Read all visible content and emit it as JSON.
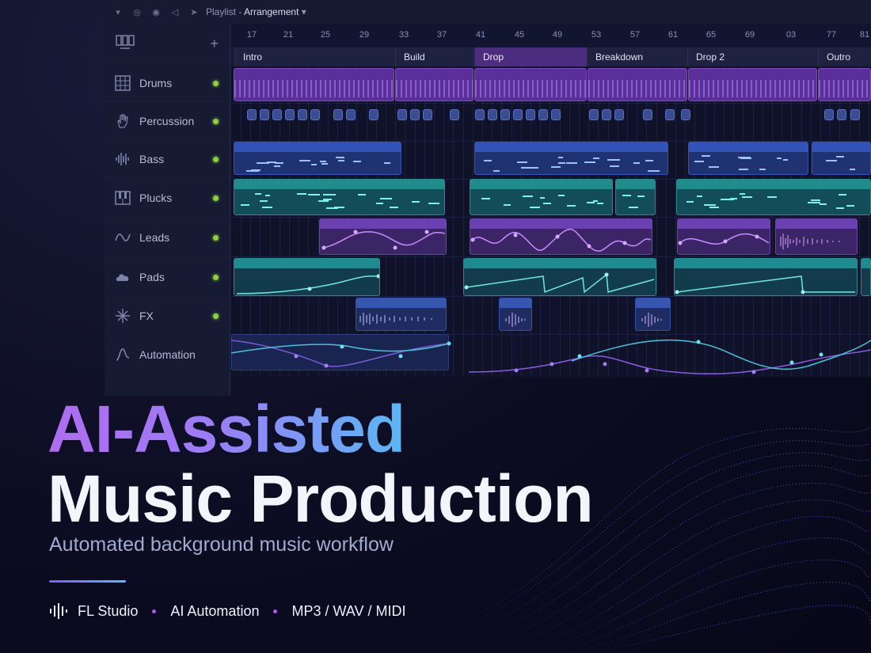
{
  "topbar": {
    "icons": [
      "chevron-down-icon",
      "headphones-icon",
      "record-icon",
      "speaker-icon",
      "arrow-icon"
    ],
    "title_prefix": "Playlist",
    "title_separator": " - ",
    "title_main": "Arrangement",
    "dropdown_icon": "▾"
  },
  "sidebar": {
    "add_label": "+",
    "tracks": [
      {
        "name": "Drums",
        "icon": "grid-icon",
        "active": true
      },
      {
        "name": "Percussion",
        "icon": "hand-icon",
        "active": true
      },
      {
        "name": "Bass",
        "icon": "waveform-icon",
        "active": true
      },
      {
        "name": "Plucks",
        "icon": "piano-keys-icon",
        "active": true
      },
      {
        "name": "Leads",
        "icon": "sine-wave-icon",
        "active": true
      },
      {
        "name": "Pads",
        "icon": "cloud-icon",
        "active": true
      },
      {
        "name": "FX",
        "icon": "sparkle-icon",
        "active": true
      },
      {
        "name": "Automation",
        "icon": "curve-icon",
        "active": false
      }
    ]
  },
  "ruler": {
    "bars": [
      "17",
      "21",
      "25",
      "29",
      "33",
      "37",
      "41",
      "45",
      "49",
      "53",
      "57",
      "61",
      "65",
      "69",
      "03",
      "77",
      "81"
    ]
  },
  "sections": [
    {
      "label": "Intro"
    },
    {
      "label": "Build"
    },
    {
      "label": "Drop"
    },
    {
      "label": "Breakdown"
    },
    {
      "label": "Drop 2"
    },
    {
      "label": "Outro"
    }
  ],
  "headline": {
    "line1": "AI-Assisted",
    "line2": "Music Production",
    "subtitle": "Automated background music workflow"
  },
  "tags": {
    "icon": "waveform-icon",
    "items": [
      "FL Studio",
      "AI Automation",
      "MP3 / WAV / MIDI"
    ]
  },
  "colors": {
    "accent_purple": "#a55cf0",
    "accent_blue": "#59b7f4",
    "track_active_dot": "#8fcf3c",
    "background": "#0a0a1e"
  }
}
